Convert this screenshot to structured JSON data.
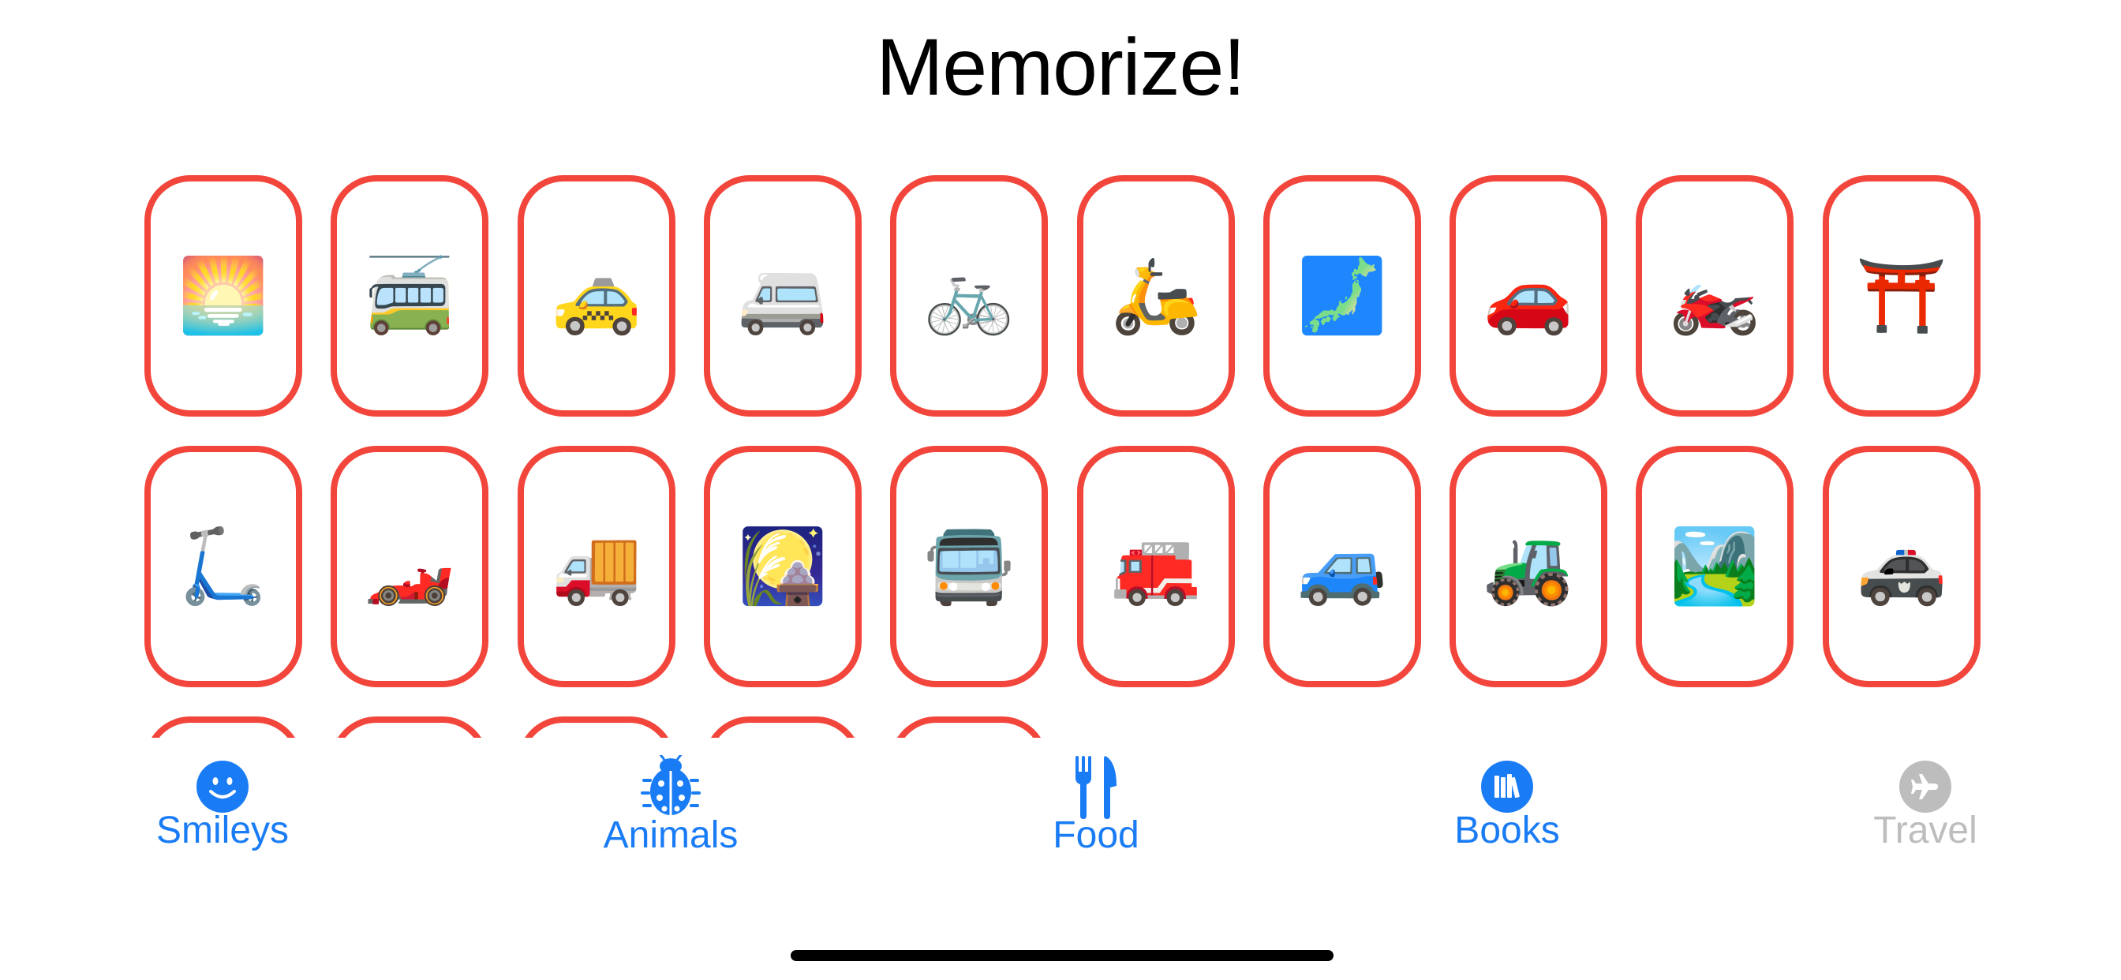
{
  "app": {
    "title": "Memorize!"
  },
  "colors": {
    "card_border": "#f2463c",
    "tab_active": "#1a7cf5",
    "tab_disabled": "#bdbdbd",
    "title": "#000000"
  },
  "cards": [
    {
      "emoji": "🌅",
      "name": "sunrise"
    },
    {
      "emoji": "🚎",
      "name": "trolleybus"
    },
    {
      "emoji": "🚕",
      "name": "taxi"
    },
    {
      "emoji": "🚐",
      "name": "minibus"
    },
    {
      "emoji": "🚲",
      "name": "bicycle"
    },
    {
      "emoji": "🛵",
      "name": "motor-scooter"
    },
    {
      "emoji": "🗾",
      "name": "map-of-japan"
    },
    {
      "emoji": "🚗",
      "name": "automobile"
    },
    {
      "emoji": "🏍️",
      "name": "motorcycle"
    },
    {
      "emoji": "⛩️",
      "name": "shinto-shrine"
    },
    {
      "emoji": "🛴",
      "name": "kick-scooter"
    },
    {
      "emoji": "🏎️",
      "name": "racing-car"
    },
    {
      "emoji": "🚚",
      "name": "delivery-truck"
    },
    {
      "emoji": "🎑",
      "name": "moon-viewing-ceremony"
    },
    {
      "emoji": "🚍",
      "name": "oncoming-bus"
    },
    {
      "emoji": "🚒",
      "name": "fire-engine"
    },
    {
      "emoji": "🚙",
      "name": "sport-utility-vehicle"
    },
    {
      "emoji": "🚜",
      "name": "tractor"
    },
    {
      "emoji": "🏞️",
      "name": "national-park"
    },
    {
      "emoji": "🚓",
      "name": "police-car"
    },
    {
      "emoji": "",
      "name": "card-partial"
    },
    {
      "emoji": "",
      "name": "card-partial"
    },
    {
      "emoji": "",
      "name": "card-partial"
    },
    {
      "emoji": "",
      "name": "card-partial"
    },
    {
      "emoji": "",
      "name": "card-partial"
    }
  ],
  "tabs": [
    {
      "label": "Smileys",
      "icon": "smiley-face-icon",
      "state": "active"
    },
    {
      "label": "Animals",
      "icon": "ladybug-icon",
      "state": "active"
    },
    {
      "label": "Food",
      "icon": "fork-knife-icon",
      "state": "active"
    },
    {
      "label": "Books",
      "icon": "books-icon",
      "state": "active"
    },
    {
      "label": "Travel",
      "icon": "airplane-icon",
      "state": "disabled"
    }
  ]
}
